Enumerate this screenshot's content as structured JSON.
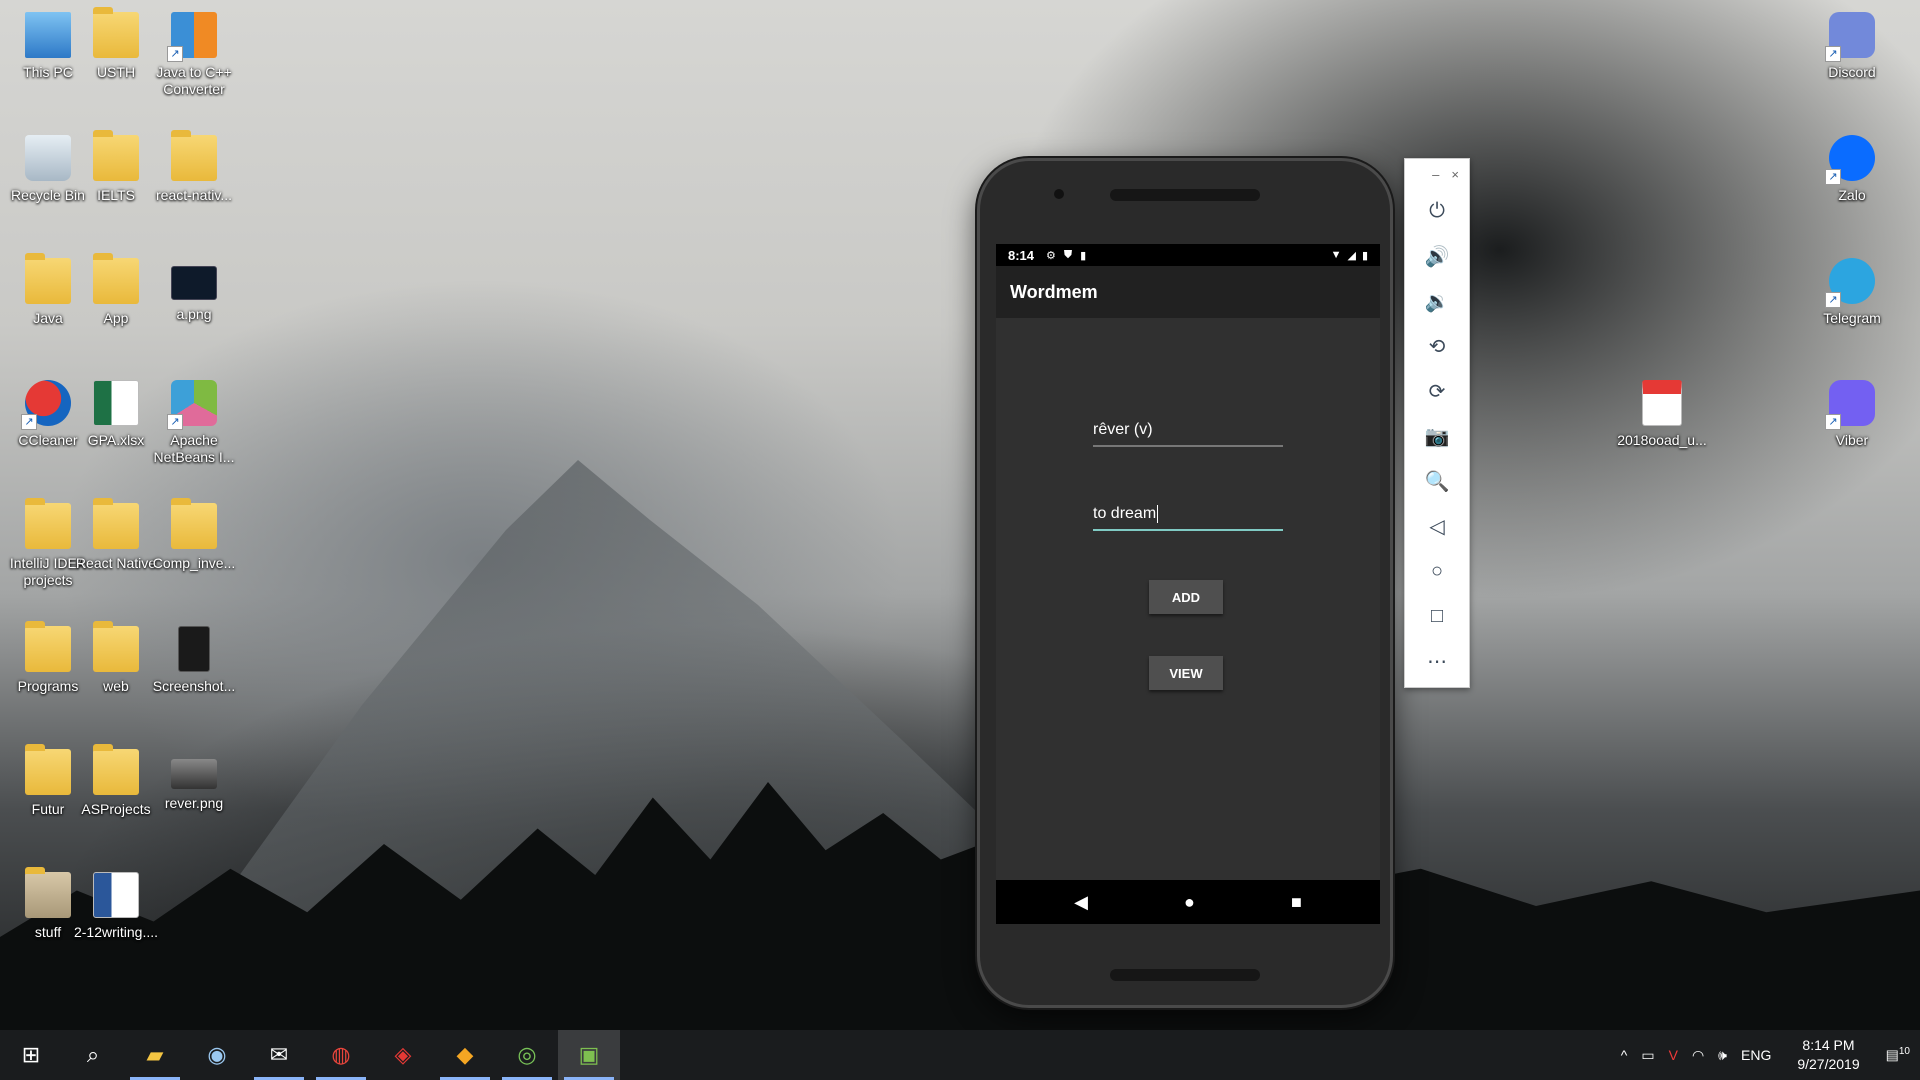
{
  "desktop": {
    "left_icons": [
      {
        "label": "This PC",
        "icon": "computer-icon"
      },
      {
        "label": "USTH",
        "icon": "folder-icon"
      },
      {
        "label": "Java to C++ Converter",
        "icon": "converter-app-icon"
      },
      {
        "label": "Recycle Bin",
        "icon": "recycle-bin-icon"
      },
      {
        "label": "IELTS",
        "icon": "folder-icon"
      },
      {
        "label": "react-nativ...",
        "icon": "folder-icon"
      },
      {
        "label": "Java",
        "icon": "folder-icon"
      },
      {
        "label": "App",
        "icon": "folder-icon"
      },
      {
        "label": "a.png",
        "icon": "image-file-icon"
      },
      {
        "label": "CCleaner",
        "icon": "ccleaner-icon"
      },
      {
        "label": "GPA.xlsx",
        "icon": "excel-file-icon"
      },
      {
        "label": "Apache NetBeans I...",
        "icon": "netbeans-icon"
      },
      {
        "label": "IntelliJ IDEA projects",
        "icon": "folder-icon"
      },
      {
        "label": "React Native",
        "icon": "folder-icon"
      },
      {
        "label": "Comp_inve...",
        "icon": "folder-icon"
      },
      {
        "label": "Programs",
        "icon": "folder-icon"
      },
      {
        "label": "web",
        "icon": "folder-icon"
      },
      {
        "label": "Screenshot...",
        "icon": "image-file-icon"
      },
      {
        "label": "Futur",
        "icon": "folder-icon"
      },
      {
        "label": "ASProjects",
        "icon": "folder-icon"
      },
      {
        "label": "rever.png",
        "icon": "image-file-icon"
      },
      {
        "label": "stuff",
        "icon": "folder-icon"
      },
      {
        "label": "2-12writing....",
        "icon": "word-file-icon"
      }
    ],
    "right_icons": [
      {
        "label": "Discord",
        "icon": "discord-icon"
      },
      {
        "label": "Zalo",
        "icon": "zalo-icon"
      },
      {
        "label": "Telegram",
        "icon": "telegram-icon"
      },
      {
        "label": "Viber",
        "icon": "viber-icon"
      },
      {
        "label": "2018ooad_u...",
        "icon": "pdf-file-icon"
      }
    ]
  },
  "emulator": {
    "status_time": "8:14",
    "app_title": "Wordmem",
    "word_field": "rêver (v)",
    "meaning_field": "to dream",
    "add_button": "ADD",
    "view_button": "VIEW",
    "nav": {
      "back": "◀",
      "home": "●",
      "recents": "■"
    },
    "toolbar": {
      "minimize": "–",
      "close": "×",
      "tools": [
        "⏻",
        "🔊",
        "🔉",
        "⟲",
        "⟳",
        "📷",
        "🔍",
        "◁",
        "○",
        "□",
        "⋯"
      ],
      "tool_names": [
        "power-icon",
        "volume-up-icon",
        "volume-down-icon",
        "rotate-left-icon",
        "rotate-right-icon",
        "camera-icon",
        "zoom-icon",
        "back-icon",
        "home-icon",
        "overview-icon",
        "more-icon"
      ]
    }
  },
  "taskbar": {
    "language": "ENG",
    "time": "8:14 PM",
    "date": "9/27/2019",
    "notification_count": "10"
  },
  "colors": {
    "accent_teal": "#80cbc4",
    "taskbar": "#1a1c1e"
  }
}
